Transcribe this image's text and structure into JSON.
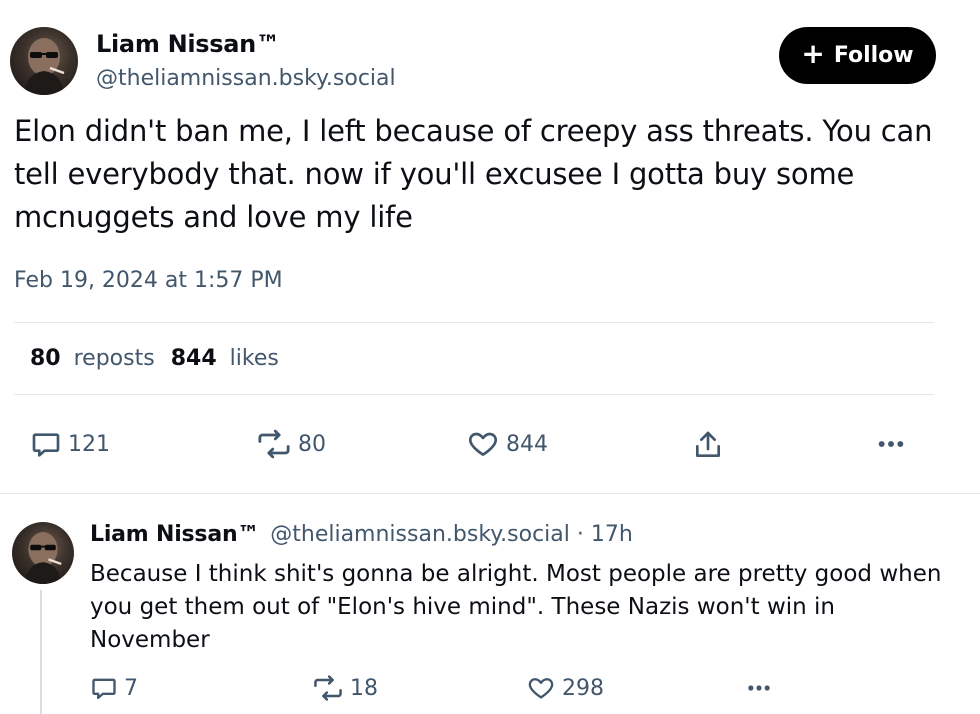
{
  "post": {
    "author_name": "Liam Nissan™",
    "author_handle": "@theliamnissan.bsky.social",
    "follow_label": "Follow",
    "follow_icon": "plus-icon",
    "text": "Elon didn't ban me, I left because of creepy ass threats. You can tell everybody that. now if you'll excusee I gotta buy some mcnuggets and love my life",
    "timestamp": "Feb 19, 2024 at 1:57 PM",
    "stats": {
      "reposts_count": "80",
      "reposts_label": "reposts",
      "likes_count": "844",
      "likes_label": "likes"
    },
    "actions": {
      "reply_count": "121",
      "repost_count": "80",
      "like_count": "844"
    }
  },
  "reply": {
    "author_name": "Liam Nissan™",
    "author_handle": "@theliamnissan.bsky.social",
    "separator": "·",
    "time_ago": "17h",
    "text": "Because I think shit's gonna be alright. Most people are pretty good when you get them out of \"Elon's hive mind\". These Nazis won't win in November",
    "actions": {
      "reply_count": "7",
      "repost_count": "18",
      "like_count": "298"
    }
  },
  "icons": {
    "reply": "speech-bubble-icon",
    "repost": "repost-arrows-icon",
    "like": "heart-icon",
    "share": "share-icon",
    "more": "more-dots-icon"
  },
  "colors": {
    "text_primary": "#0b0f14",
    "text_secondary": "#42576c",
    "follow_bg": "#000000",
    "divider": "#e4e8ec"
  }
}
